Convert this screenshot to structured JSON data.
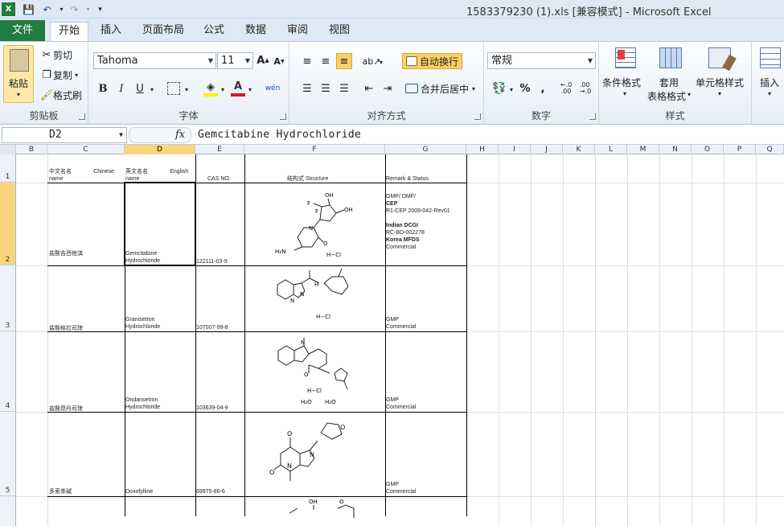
{
  "window": {
    "title": "1583379230 (1).xls  [兼容模式]  -  Microsoft Excel"
  },
  "tabs": [
    "文件",
    "开始",
    "插入",
    "页面布局",
    "公式",
    "数据",
    "审阅",
    "视图"
  ],
  "ribbon": {
    "clipboard": {
      "paste": "粘贴",
      "cut": "剪切",
      "copy": "复制",
      "format_painter": "格式刷",
      "label": "剪贴板"
    },
    "font": {
      "name": "Tahoma",
      "size": "11",
      "bold": "B",
      "italic": "I",
      "underline": "U",
      "label": "字体"
    },
    "alignment": {
      "wrap": "自动换行",
      "merge": "合并后居中",
      "label": "对齐方式"
    },
    "number": {
      "format": "常规",
      "percent": "%",
      "comma": ",",
      "inc": ".0\n.00",
      "dec": ".00\n.0",
      "label": "数字"
    },
    "styles": {
      "cond": "条件格式",
      "table_line1": "套用",
      "table_line2": "表格格式",
      "cell": "单元格样式",
      "label": "样式"
    },
    "cells": {
      "insert": "插入"
    }
  },
  "formula_bar": {
    "name_box": "D2",
    "fx": "fx",
    "formula": "Gemcitabine Hydrochloride"
  },
  "columns": [
    "B",
    "C",
    "D",
    "E",
    "F",
    "G",
    "H",
    "I",
    "J",
    "K",
    "L",
    "M",
    "N",
    "O",
    "P",
    "Q"
  ],
  "rows": [
    "1",
    "2",
    "3",
    "4",
    "5"
  ],
  "header_row": {
    "c": "中文名名              Chinese",
    "c2": "name",
    "d": "英文名名              English",
    "d2": "name",
    "e": "CAS NO.",
    "f": "结构式 Structure",
    "g": "Remark & Status"
  },
  "data_rows": [
    {
      "c": "盐酸吉西他滨",
      "d1": "Gemcitabine",
      "d2": "Hydrochloride",
      "e": "122111-03-9",
      "g": [
        "GMP/ DMF/",
        "CEP",
        "R1-CEP 2009-042-Rev01",
        "",
        "Indian DCGI",
        "RC-BD-002278",
        "Korea MFDS",
        "Commercial"
      ]
    },
    {
      "c": "盐酸格拉司琼",
      "d1": "Granisetron",
      "d2": "Hydrochloride",
      "e": "107007-99-8",
      "g": [
        "GMP",
        "Commercial"
      ]
    },
    {
      "c": "盐酸昂丹司琼",
      "d1": "Ondansetron",
      "d2": "Hydrochloride",
      "e": "103639-04-9",
      "g": [
        "GMP",
        "Commercial"
      ]
    },
    {
      "c": "多索茶碱",
      "d1": "Doxofylline",
      "d2": "",
      "e": "69975-86-6",
      "g": [
        "GMP",
        "Commercial"
      ]
    }
  ],
  "structure_labels": {
    "r2": {
      "a": "OH",
      "b": "OH",
      "c": "F",
      "d": "F",
      "e": "N",
      "f": "O",
      "g": "H₂N",
      "h": "H−Cl"
    },
    "r3": {
      "a": "H−Cl",
      "b": "N",
      "c": "N",
      "d": "H"
    },
    "r4": {
      "a": "H−Cl",
      "b": "H₂O",
      "c": "H₂O",
      "d": "N",
      "e": "O"
    },
    "r5": {
      "a": "O",
      "b": "N",
      "c": "N",
      "d": "O",
      "e": "O"
    },
    "r6": {
      "a": "OH",
      "b": "O"
    }
  }
}
